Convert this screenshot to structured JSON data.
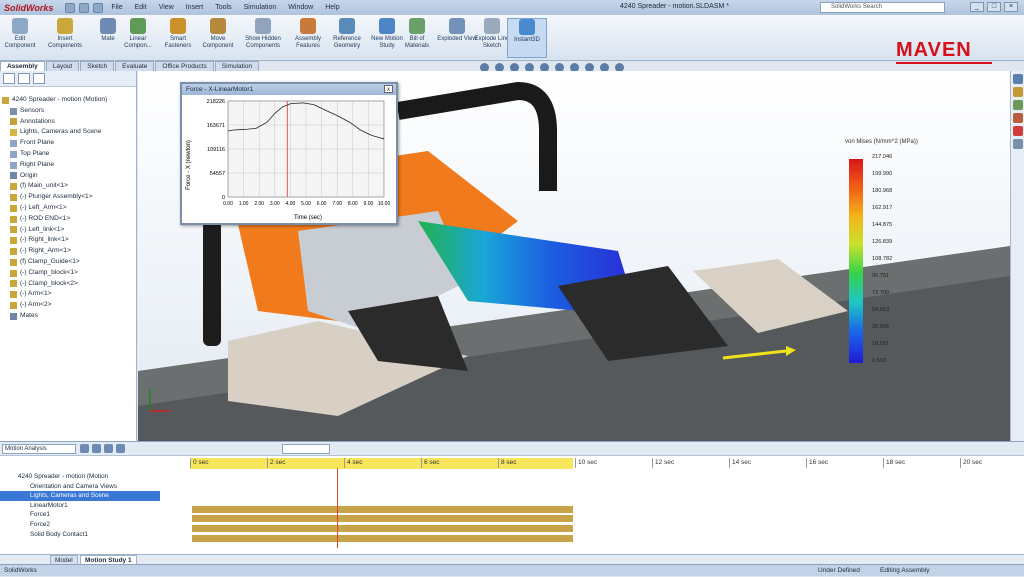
{
  "app": {
    "logo": "SolidWorks",
    "document_title": "4240 Spreader - motion.SLDASM *",
    "search_placeholder": "SolidWorks Search",
    "menu": [
      "File",
      "Edit",
      "View",
      "Insert",
      "Tools",
      "Simulation",
      "Window",
      "Help"
    ]
  },
  "brand": "MAVEN",
  "ribbon": [
    {
      "label": "Edit Component",
      "color": "#8ea9c8"
    },
    {
      "label": "Insert Components",
      "color": "#caa73b"
    },
    {
      "label": "Mate",
      "color": "#6d8ab2"
    },
    {
      "label": "Linear Compon...",
      "color": "#5f9a59"
    },
    {
      "label": "Smart Fasteners",
      "color": "#c9902c"
    },
    {
      "label": "Move Component",
      "color": "#b58a3c"
    },
    {
      "label": "Show Hidden Components",
      "color": "#90a4bd"
    },
    {
      "label": "Assembly Features",
      "color": "#c77a3a"
    },
    {
      "label": "Reference Geometry",
      "color": "#5b8bb8"
    },
    {
      "label": "New Motion Study",
      "color": "#4c86c6"
    },
    {
      "label": "Bill of Materials",
      "color": "#6aa16a"
    },
    {
      "label": "Exploded View",
      "color": "#7292bb"
    },
    {
      "label": "Explode Line Sketch",
      "color": "#99a9be"
    },
    {
      "label": "Instant3D",
      "color": "#4a8ad0"
    }
  ],
  "command_tabs": [
    "Assembly",
    "Layout",
    "Sketch",
    "Evaluate",
    "Office Products",
    "Simulation"
  ],
  "feature_tree": [
    {
      "label": "4240 Spreader - motion  (Motion)",
      "color": "#caa73b"
    },
    {
      "label": "Sensors",
      "color": "#7a8fa9"
    },
    {
      "label": "Annotations",
      "color": "#c4a23b"
    },
    {
      "label": "Lights, Cameras and Scene",
      "color": "#d2b84a"
    },
    {
      "label": "Front Plane",
      "color": "#8fa6c4"
    },
    {
      "label": "Top Plane",
      "color": "#8fa6c4"
    },
    {
      "label": "Right Plane",
      "color": "#8fa6c4"
    },
    {
      "label": "Origin",
      "color": "#6f86a8"
    },
    {
      "label": "(f) Main_unit<1>",
      "color": "#caa73b"
    },
    {
      "label": "(-) Plunger Assembly<1>",
      "color": "#caa73b"
    },
    {
      "label": "(-) Left_Arm<1>",
      "color": "#caa73b"
    },
    {
      "label": "(-) ROD END<1>",
      "color": "#caa73b"
    },
    {
      "label": "(-) Left_link<1>",
      "color": "#caa73b"
    },
    {
      "label": "(-) Right_link<1>",
      "color": "#caa73b"
    },
    {
      "label": "(-) Right_Arm<1>",
      "color": "#caa73b"
    },
    {
      "label": "(f) Clamp_Guide<1>",
      "color": "#caa73b"
    },
    {
      "label": "(-) Clamp_block<1>",
      "color": "#caa73b"
    },
    {
      "label": "(-) Clamp_block<2>",
      "color": "#caa73b"
    },
    {
      "label": "(-) Arm<1>",
      "color": "#caa73b"
    },
    {
      "label": "(-) Arm<2>",
      "color": "#caa73b"
    },
    {
      "label": "Mates",
      "color": "#6f86a8"
    }
  ],
  "graph": {
    "title": "Force - X-LinearMotor1",
    "close": "x",
    "ylabel": "Force - X (newton)",
    "xlabel": "Time (sec)",
    "yticks": [
      "218226",
      "163671",
      "109116",
      "54557",
      "0"
    ],
    "xticks": [
      "0.00",
      "1.00",
      "2.00",
      "3.00",
      "4.00",
      "5.00",
      "6.00",
      "7.00",
      "8.00",
      "9.00",
      "10.00"
    ]
  },
  "chart_data": {
    "type": "line",
    "title": "Force - X-LinearMotor1",
    "xlabel": "Time (sec)",
    "ylabel": "Force - X (newton)",
    "xlim": [
      0,
      10
    ],
    "ylim": [
      0,
      218226
    ],
    "x": [
      0,
      0.3,
      0.7,
      1.2,
      1.8,
      2.5,
      3.0,
      3.5,
      4.0,
      4.8,
      5.5,
      6.2,
      7.0,
      7.8,
      8.5,
      9.2,
      10
    ],
    "series": [
      {
        "values": [
          150000,
          152000,
          153000,
          154000,
          156000,
          170000,
          190000,
          205000,
          212000,
          214000,
          210000,
          198000,
          185000,
          170000,
          152000,
          140000,
          132000
        ]
      }
    ],
    "grid": true
  },
  "legend": {
    "title": "von Mises (N/mm^2 (MPa))",
    "values": [
      "217.046",
      "199.990",
      "180.968",
      "162.917",
      "144.875",
      "126.839",
      "108.782",
      "90.751",
      "72.700",
      "54.653",
      "36.605",
      "18.551",
      "0.593"
    ]
  },
  "motion_manager": {
    "analysis_type": "Motion Analysis",
    "timeline_ticks": [
      "0 sec",
      "2 sec",
      "4 sec",
      "6 sec",
      "8 sec",
      "10 sec",
      "12 sec",
      "14 sec",
      "16 sec",
      "18 sec",
      "20 sec"
    ],
    "tree": [
      {
        "label": "4240 Spreader - motion  (Motion",
        "selected": false
      },
      {
        "label": "Orientation and Camera Views",
        "selected": false
      },
      {
        "label": "Lights, Cameras and Scene",
        "selected": true
      },
      {
        "label": "LinearMotor1",
        "selected": false
      },
      {
        "label": "Force1",
        "selected": false
      },
      {
        "label": "Force2",
        "selected": false
      },
      {
        "label": "Solid Body Contact1",
        "selected": false
      }
    ]
  },
  "bottom_tabs": [
    "Model",
    "Motion Study 1"
  ],
  "status": {
    "app": "SolidWorks",
    "state": "Under Defined",
    "mode": "Editing Assembly"
  }
}
